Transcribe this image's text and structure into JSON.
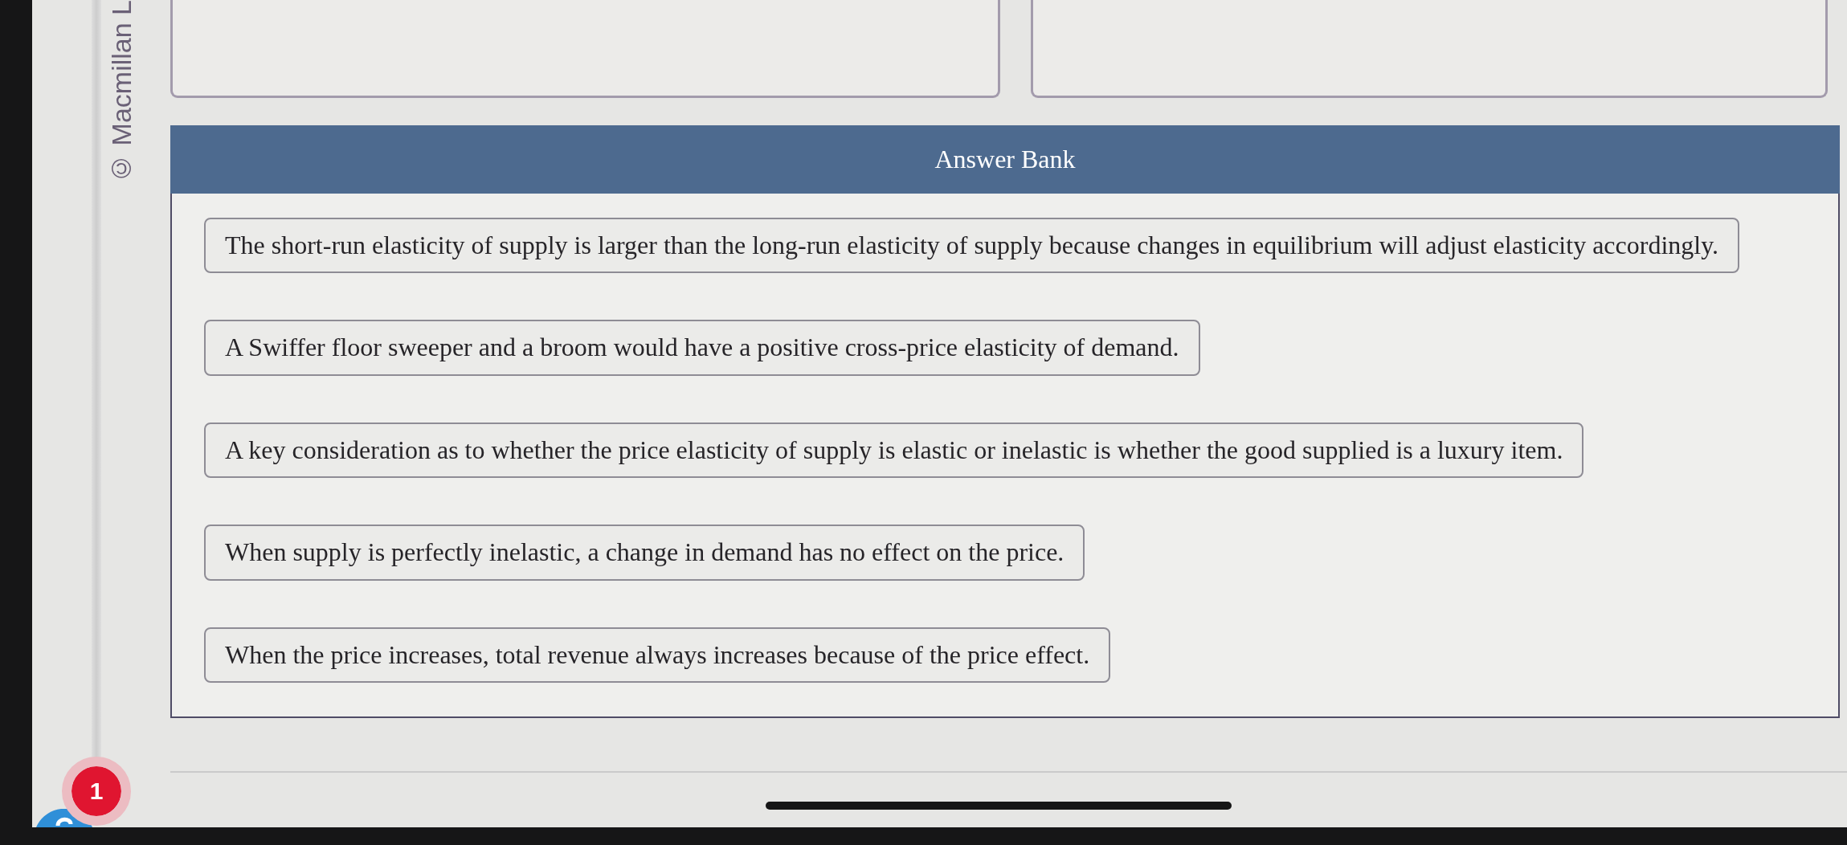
{
  "copyright": "© Macmillan L",
  "drop_zones": [
    {
      "kind": "answer_slot"
    },
    {
      "kind": "answer_slot"
    }
  ],
  "answer_bank": {
    "title": "Answer Bank",
    "items": [
      "The short-run elasticity of supply is larger than the long-run elasticity of supply because changes in equilibrium will adjust elasticity accordingly.",
      "A Swiffer floor sweeper and a broom would have a positive cross-price elasticity of demand.",
      "A key consideration as to whether the price elasticity of supply is elastic or inelastic is whether the good supplied is a luxury item.",
      "When supply is perfectly inelastic, a change in demand has no effect on the price.",
      "When the price increases, total revenue always increases because of the price effect."
    ]
  },
  "notification_badge": {
    "count": "1"
  }
}
